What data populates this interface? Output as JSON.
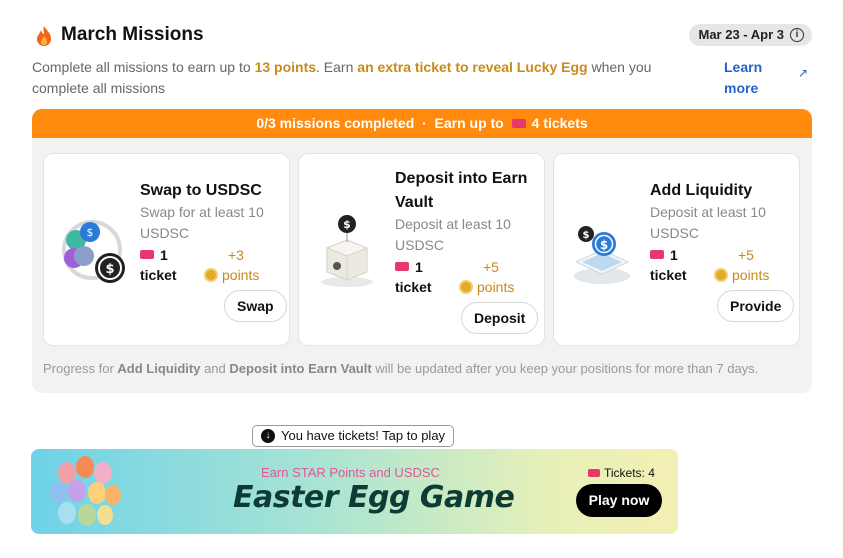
{
  "header": {
    "title": "March Missions",
    "date_range": "Mar 23 - Apr 3",
    "icons": [
      "flame-icon",
      "info-icon"
    ]
  },
  "description": {
    "part1": "Complete all missions to earn up to ",
    "points": "13 points",
    "part2": ". Earn ",
    "highlight": "an extra ticket to reveal Lucky Egg",
    "part3": " when you complete all missions",
    "learn_more": "Learn more"
  },
  "progress_banner": {
    "completed": "0/3 missions completed",
    "separator": "·",
    "earn_prefix": "Earn up to",
    "tickets": "4 tickets"
  },
  "missions": [
    {
      "title": "Swap to USDSC",
      "subtitle": "Swap for at least 10 USDSC",
      "ticket_count": "1",
      "ticket_label": "ticket",
      "points_value": "+3",
      "points_label": "points",
      "button": "Swap"
    },
    {
      "title": "Deposit into Earn Vault",
      "subtitle": "Deposit at least 10 USDSC",
      "ticket_count": "1",
      "ticket_label": "ticket",
      "points_value": "+5",
      "points_label": "points",
      "button": "Deposit"
    },
    {
      "title": "Add Liquidity",
      "subtitle": "Deposit at least 10 USDSC",
      "ticket_count": "1",
      "ticket_label": "ticket",
      "points_value": "+5",
      "points_label": "points",
      "button": "Provide"
    }
  ],
  "note": {
    "prefix": "Progress for ",
    "item1": "Add Liquidity",
    "and": " and ",
    "item2": "Deposit into Earn Vault",
    "suffix": " will be updated after you keep your positions for more than 7 days."
  },
  "tooltip": "You have tickets! Tap to play",
  "game_banner": {
    "subtitle": "Earn STAR Points and USDSC",
    "title": "Easter Egg Game",
    "tickets": "Tickets: 4",
    "play_button": "Play now"
  },
  "colors": {
    "accent_orange": "#ff8a0d",
    "points_gold": "#c98a1c",
    "link_blue": "#2563c9",
    "ticket_pink": "#e8386b"
  }
}
